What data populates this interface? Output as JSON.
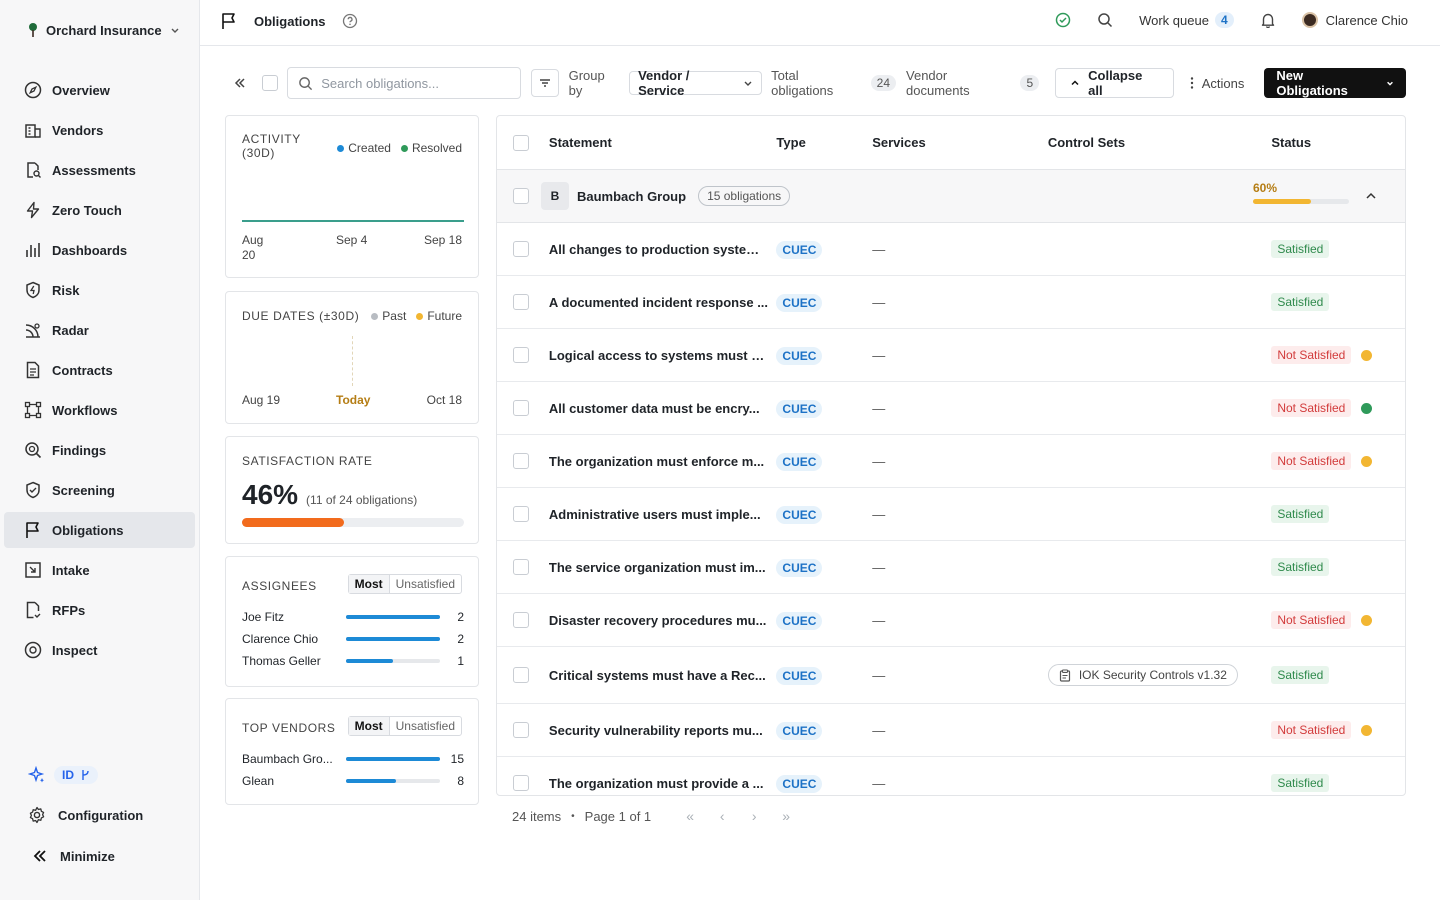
{
  "org": {
    "name": "Orchard Insurance"
  },
  "nav": [
    {
      "key": "overview",
      "label": "Overview"
    },
    {
      "key": "vendors",
      "label": "Vendors"
    },
    {
      "key": "assessments",
      "label": "Assessments"
    },
    {
      "key": "zero-touch",
      "label": "Zero Touch"
    },
    {
      "key": "dashboards",
      "label": "Dashboards"
    },
    {
      "key": "risk",
      "label": "Risk"
    },
    {
      "key": "radar",
      "label": "Radar"
    },
    {
      "key": "contracts",
      "label": "Contracts"
    },
    {
      "key": "workflows",
      "label": "Workflows"
    },
    {
      "key": "findings",
      "label": "Findings"
    },
    {
      "key": "screening",
      "label": "Screening"
    },
    {
      "key": "obligations",
      "label": "Obligations"
    },
    {
      "key": "intake",
      "label": "Intake"
    },
    {
      "key": "rfps",
      "label": "RFPs"
    },
    {
      "key": "inspect",
      "label": "Inspect"
    }
  ],
  "sidebar_bottom": {
    "id_badge": "ID",
    "configuration": "Configuration",
    "minimize": "Minimize"
  },
  "header": {
    "title": "Obligations",
    "work_queue": "Work queue",
    "work_queue_count": "4",
    "user": "Clarence Chio"
  },
  "toolbar": {
    "search_placeholder": "Search obligations...",
    "group_by_label": "Group by",
    "group_by_value": "Vendor / Service",
    "total_label": "Total obligations",
    "total_count": "24",
    "vendor_docs_label": "Vendor documents",
    "vendor_docs_count": "5",
    "collapse_all": "Collapse all",
    "actions": "Actions",
    "new_button": "New Obligations"
  },
  "activity": {
    "title": "ACTIVITY (30D)",
    "legend_created": "Created",
    "legend_resolved": "Resolved",
    "ticks": [
      "Aug 20",
      "Sep 4",
      "Sep 18"
    ]
  },
  "due_dates": {
    "title": "DUE DATES (±30D)",
    "legend_past": "Past",
    "legend_future": "Future",
    "ticks": [
      "Aug 19",
      "Today",
      "Oct 18"
    ]
  },
  "satisfaction": {
    "title": "SATISFACTION RATE",
    "value": "46%",
    "detail": "(11 of 24 obligations)",
    "fraction": 0.46
  },
  "assignees": {
    "title": "ASSIGNEES",
    "tab_most": "Most",
    "tab_unsatisfied": "Unsatisfied",
    "max": 2,
    "items": [
      {
        "name": "Joe Fitz",
        "count": "2",
        "value": 2
      },
      {
        "name": "Clarence Chio",
        "count": "2",
        "value": 2
      },
      {
        "name": "Thomas Geller",
        "count": "1",
        "value": 1
      }
    ]
  },
  "top_vendors": {
    "title": "TOP VENDORS",
    "tab_most": "Most",
    "tab_unsatisfied": "Unsatisfied",
    "max": 15,
    "items": [
      {
        "name": "Baumbach Gro...",
        "count": "15",
        "value": 15
      },
      {
        "name": "Glean",
        "count": "8",
        "value": 8
      }
    ]
  },
  "table": {
    "columns": {
      "statement": "Statement",
      "type": "Type",
      "services": "Services",
      "control_sets": "Control Sets",
      "status": "Status"
    },
    "group": {
      "initial": "B",
      "name": "Baumbach Group",
      "count_label": "15 obligations",
      "progress_label": "60%",
      "progress": 0.6
    },
    "rows": [
      {
        "statement": "All changes to production system...",
        "type": "CUEC",
        "services": "—",
        "control_set": "",
        "status": "Satisfied",
        "dot": ""
      },
      {
        "statement": "A documented incident response ...",
        "type": "CUEC",
        "services": "—",
        "control_set": "",
        "status": "Satisfied",
        "dot": ""
      },
      {
        "statement": "Logical access to systems must b...",
        "type": "CUEC",
        "services": "—",
        "control_set": "",
        "status": "Not Satisfied",
        "dot": "#f2b632"
      },
      {
        "statement": "All customer data must be encry...",
        "type": "CUEC",
        "services": "—",
        "control_set": "",
        "status": "Not Satisfied",
        "dot": "#2f9a5a"
      },
      {
        "statement": "The organization must enforce m...",
        "type": "CUEC",
        "services": "—",
        "control_set": "",
        "status": "Not Satisfied",
        "dot": "#f2b632"
      },
      {
        "statement": "Administrative users must imple...",
        "type": "CUEC",
        "services": "—",
        "control_set": "",
        "status": "Satisfied",
        "dot": ""
      },
      {
        "statement": "The service organization must im...",
        "type": "CUEC",
        "services": "—",
        "control_set": "",
        "status": "Satisfied",
        "dot": ""
      },
      {
        "statement": "Disaster recovery procedures mu...",
        "type": "CUEC",
        "services": "—",
        "control_set": "",
        "status": "Not Satisfied",
        "dot": "#f2b632"
      },
      {
        "statement": "Critical systems must have a Rec...",
        "type": "CUEC",
        "services": "—",
        "control_set": "IOK Security Controls v1.32",
        "status": "Satisfied",
        "dot": ""
      },
      {
        "statement": "Security vulnerability reports mu...",
        "type": "CUEC",
        "services": "—",
        "control_set": "",
        "status": "Not Satisfied",
        "dot": "#f2b632"
      },
      {
        "statement": "The organization must provide a ...",
        "type": "CUEC",
        "services": "—",
        "control_set": "",
        "status": "Satisfied",
        "dot": ""
      }
    ]
  },
  "pager": {
    "items": "24 items",
    "page": "Page 1 of 1"
  },
  "colors": {
    "accent_dark": "#111111",
    "satisfied": "#2f8a4c",
    "not_satisfied": "#d23b3b",
    "created": "#1d8ad6",
    "resolved": "#2f9a5a",
    "satisfaction_bar": "#f26b1d",
    "group_progress": "#f2b632"
  }
}
